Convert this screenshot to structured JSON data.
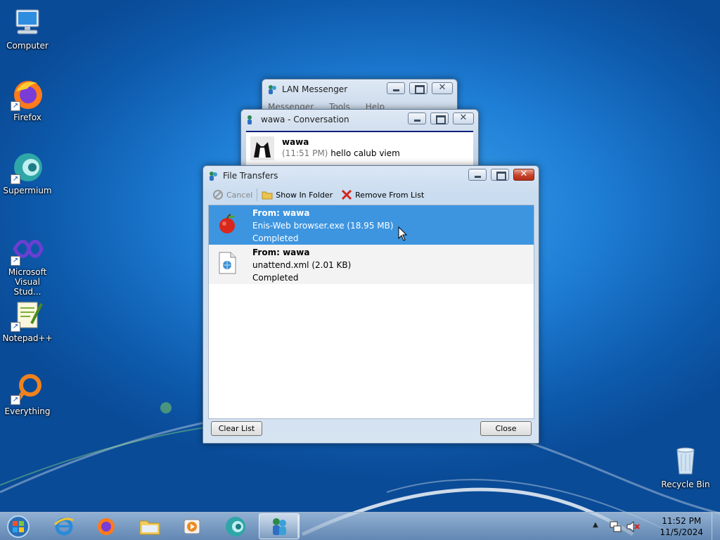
{
  "desktop": {
    "icons": [
      {
        "label": "Computer",
        "icon": "computer-icon"
      },
      {
        "label": "Firefox",
        "icon": "firefox-icon"
      },
      {
        "label": "Supermium",
        "icon": "supermium-icon"
      },
      {
        "label": "Microsoft Visual Stud...",
        "icon": "visual-studio-icon"
      },
      {
        "label": "Notepad++",
        "icon": "notepadpp-icon"
      },
      {
        "label": "Everything",
        "icon": "everything-icon"
      },
      {
        "label": "Recycle Bin",
        "icon": "recycle-bin-icon"
      }
    ]
  },
  "lan_messenger": {
    "title": "LAN Messenger",
    "menu": [
      "Messenger",
      "Tools",
      "Help"
    ]
  },
  "conversation": {
    "title": "wawa - Conversation",
    "sender": "wawa",
    "time": "(11:51 PM)",
    "message": "hello calub viem"
  },
  "file_transfers": {
    "title": "File Transfers",
    "toolbar": {
      "cancel": "Cancel",
      "show_in_folder": "Show In Folder",
      "remove_from_list": "Remove From List"
    },
    "items": [
      {
        "from": "From: wawa",
        "file": "Enis-Web browser.exe (18.95 MB)",
        "status": "Completed",
        "selected": true,
        "icon": "apple-app-icon"
      },
      {
        "from": "From: wawa",
        "file": "unattend.xml (2.01 KB)",
        "status": "Completed",
        "selected": false,
        "icon": "xml-file-icon"
      }
    ],
    "clear_list": "Clear List",
    "close": "Close"
  },
  "taskbar": {
    "apps": [
      "start-orb",
      "internet-explorer-icon",
      "firefox-icon",
      "file-explorer-icon",
      "media-player-icon",
      "supermium-icon",
      "lan-messenger-icon"
    ],
    "clock_time": "11:52 PM",
    "clock_date": "11/5/2024"
  },
  "colors": {
    "selection": "#3d95e0",
    "desktop_blue": "#1f7fd6",
    "close_red": "#c7432b"
  }
}
